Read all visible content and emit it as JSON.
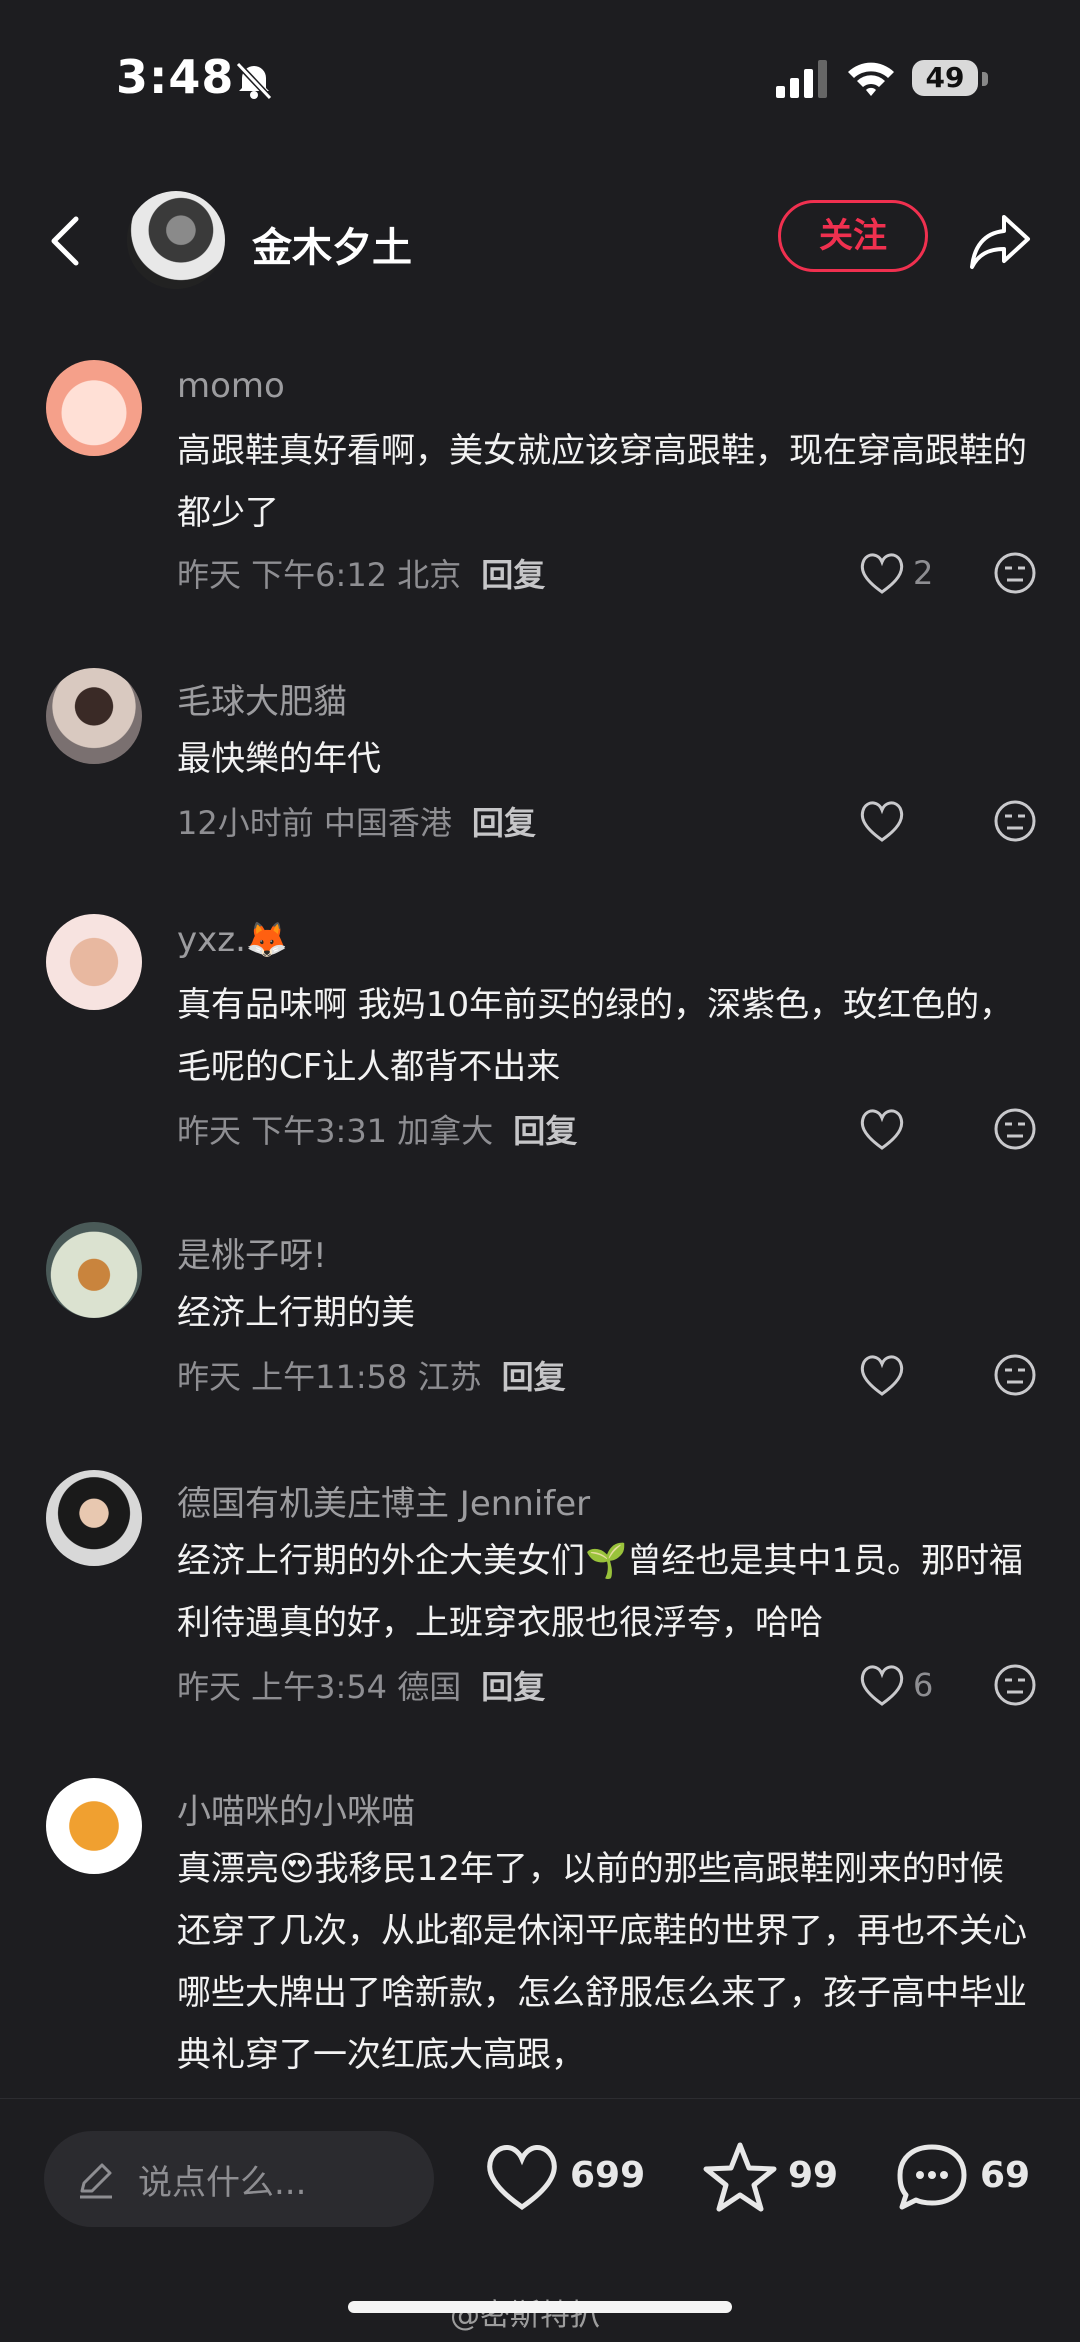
{
  "status_bar": {
    "time": "3:48",
    "battery": "49"
  },
  "header": {
    "author_name": "金木夕土",
    "follow_label": "关注"
  },
  "comments": [
    {
      "username": "momo",
      "text": "高跟鞋真好看啊，美女就应该穿高跟鞋，现在穿高跟鞋的都少了",
      "meta": "昨天 下午6:12 北京",
      "reply": "回复",
      "likes": "2"
    },
    {
      "username": "毛球大肥貓",
      "text": "最快樂的年代",
      "meta": "12小时前 中国香港",
      "reply": "回复",
      "likes": ""
    },
    {
      "username": "yxz.🦊",
      "text": "真有品味啊 我妈10年前买的绿的，深紫色，玫红色的，毛呢的CF让人都背不出来",
      "meta": "昨天 下午3:31 加拿大",
      "reply": "回复",
      "likes": ""
    },
    {
      "username": "是桃子呀!",
      "text": "经济上行期的美",
      "meta": "昨天 上午11:58 江苏",
      "reply": "回复",
      "likes": ""
    },
    {
      "username": "德国有机美庄博主 Jennifer",
      "text": "经济上行期的外企大美女们🌱曾经也是其中1员。那时福利待遇真的好，上班穿衣服也很浮夸，哈哈",
      "meta": "昨天 上午3:54 德国",
      "reply": "回复",
      "likes": "6"
    },
    {
      "username": "小喵咪的小咪喵",
      "text": "真漂亮😍我移民12年了，以前的那些高跟鞋刚来的时候还穿了几次，从此都是休闲平底鞋的世界了，再也不关心哪些大牌出了啥新款，怎么舒服怎么来了，孩子高中毕业典礼穿了一次红底大高跟，",
      "meta": "",
      "reply": "",
      "likes": ""
    }
  ],
  "bottom_bar": {
    "input_placeholder": "说点什么...",
    "likes_count": "699",
    "favorites_count": "99",
    "comments_count": "69"
  },
  "watermark": "@密斯特扒",
  "colors": {
    "background": "#1d1d20",
    "accent": "#f0304f"
  }
}
